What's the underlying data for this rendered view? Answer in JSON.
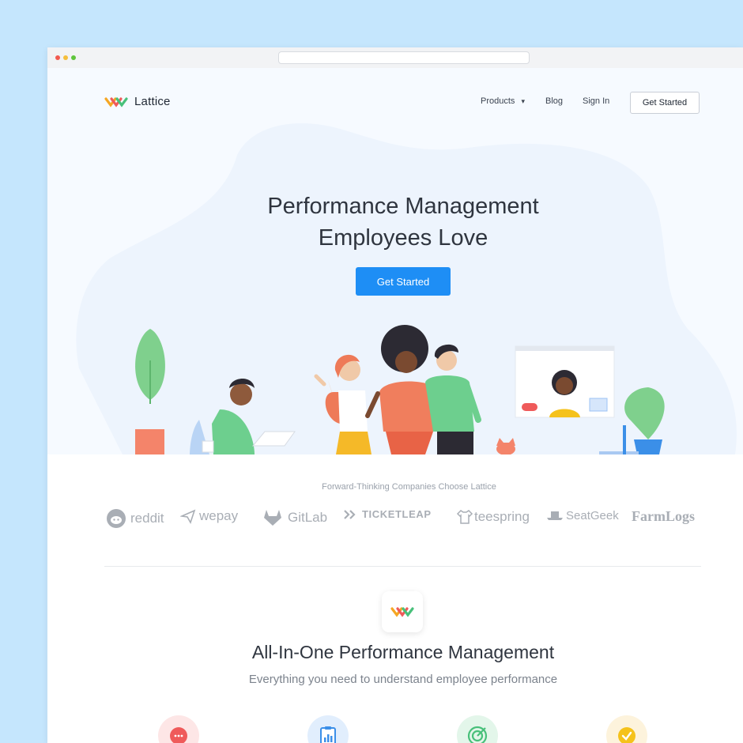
{
  "brand": {
    "name": "Lattice"
  },
  "nav": {
    "products": "Products",
    "products_caret": "▾",
    "blog": "Blog",
    "signin": "Sign In",
    "get_started": "Get Started"
  },
  "hero": {
    "headline_line1": "Performance Management",
    "headline_line2": "Employees Love",
    "cta": "Get Started"
  },
  "companies": {
    "title": "Forward-Thinking Companies Choose Lattice",
    "logos": [
      "reddit",
      "wepay",
      "GitLab",
      "TICKETLEAP",
      "teespring",
      "SeatGeek",
      "FarmLogs"
    ]
  },
  "feature": {
    "title": "All-In-One Performance Management",
    "subtitle": "Everything you need to understand employee performance"
  },
  "colors": {
    "accent": "#1e8ef5",
    "page_bg": "#c5e6fd",
    "hero_bg": "#f6faff"
  },
  "icons": [
    "chat-bubble-icon",
    "clipboard-chart-icon",
    "target-icon",
    "checkmark-icon"
  ]
}
